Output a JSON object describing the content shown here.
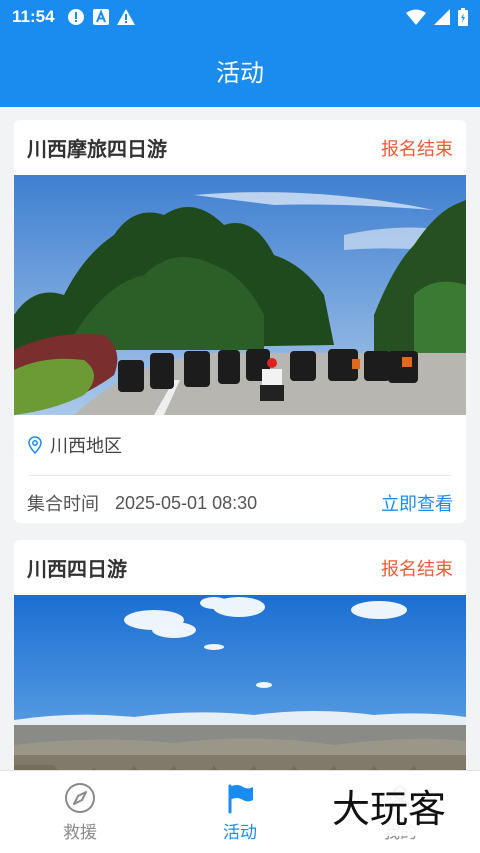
{
  "status_bar": {
    "time": "11:54",
    "icons": [
      "alert-circle-icon",
      "a-badge-icon",
      "warning-icon"
    ],
    "right_icons": [
      "wifi-icon",
      "signal-icon",
      "battery-icon"
    ]
  },
  "app_bar": {
    "title": "活动"
  },
  "activities": [
    {
      "title": "川西摩旅四日游",
      "status": "报名结束",
      "location": "川西地区",
      "meet_label": "集合时间",
      "meet_time": "2025-05-01 08:30",
      "action": "立即查看"
    },
    {
      "title": "川西四日游",
      "status": "报名结束"
    }
  ],
  "tab_bar": {
    "tabs": [
      {
        "label": "救援",
        "icon": "compass-icon"
      },
      {
        "label": "活动",
        "icon": "flag-icon"
      },
      {
        "label": "我的",
        "icon": "user-icon"
      }
    ]
  },
  "watermark": {
    "text": "大玩客"
  },
  "colors": {
    "primary": "#1a8cf0",
    "status": "#f05a35"
  }
}
